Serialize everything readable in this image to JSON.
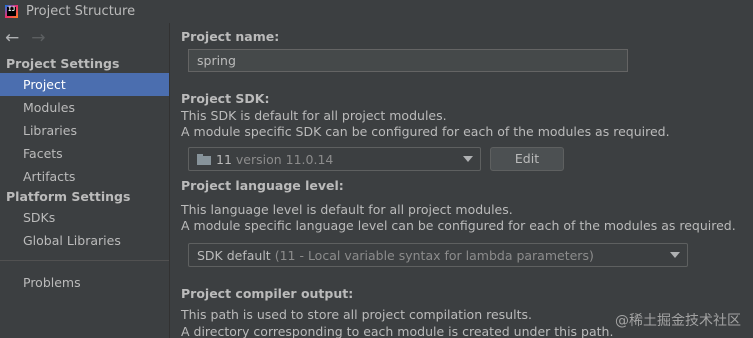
{
  "window": {
    "title": "Project Structure"
  },
  "sidebar": {
    "groups": [
      {
        "header": "Project Settings",
        "items": [
          "Project",
          "Modules",
          "Libraries",
          "Facets",
          "Artifacts"
        ]
      },
      {
        "header": "Platform Settings",
        "items": [
          "SDKs",
          "Global Libraries"
        ]
      }
    ],
    "bottom_items": [
      "Problems"
    ],
    "selected": "Project"
  },
  "main": {
    "project_name": {
      "label": "Project name:",
      "value": "spring"
    },
    "project_sdk": {
      "label": "Project SDK:",
      "desc1": "This SDK is default for all project modules.",
      "desc2": "A module specific SDK can be configured for each of the modules as required.",
      "selected_sdk": "11",
      "selected_version": "version 11.0.14",
      "edit_label": "Edit"
    },
    "language_level": {
      "label": "Project language level:",
      "desc1": "This language level is default for all project modules.",
      "desc2": "A module specific language level can be configured for each of the modules as required.",
      "selected": "SDK default",
      "selected_detail": "(11 - Local variable syntax for lambda parameters)"
    },
    "compiler_output": {
      "label": "Project compiler output:",
      "desc1": "This path is used to store all project compilation results.",
      "desc2": "A directory corresponding to each module is created under this path."
    }
  },
  "watermark": "@稀土掘金技术社区",
  "colors": {
    "selection": "#4b6eaf",
    "background": "#3c3f41",
    "text": "#bbbbbb"
  }
}
